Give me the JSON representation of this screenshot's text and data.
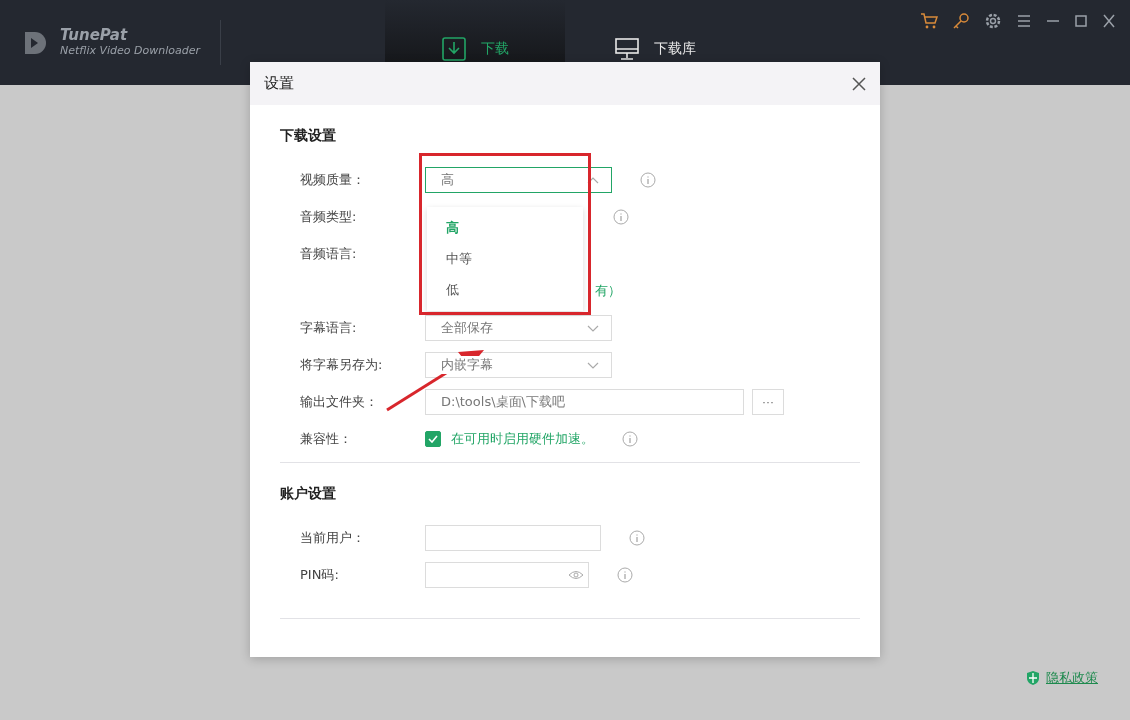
{
  "app": {
    "name": "TunePat",
    "subtitle": "Netflix Video Downloader"
  },
  "tabs": [
    {
      "label": "下载",
      "kind": "download",
      "selected": true
    },
    {
      "label": "下载库",
      "kind": "library",
      "selected": false
    }
  ],
  "dialog": {
    "title": "设置",
    "sections": [
      {
        "title": "下载设置",
        "rows": [
          {
            "label": "视频质量：",
            "kind": "select",
            "value": "高",
            "open": true,
            "info": true
          },
          {
            "label": "音频类型:",
            "kind": "covered",
            "info": true
          },
          {
            "label": "音频语言:",
            "kind": "covered",
            "info": false,
            "note": "有）"
          },
          {
            "label": "字幕语言:",
            "kind": "select",
            "value": "全部保存",
            "open": false,
            "info": false
          },
          {
            "label": "将字幕另存为:",
            "kind": "select",
            "value": "内嵌字幕",
            "open": false,
            "info": false
          },
          {
            "label": "输出文件夹：",
            "kind": "path",
            "value": "D:\\tools\\桌面\\下载吧",
            "button": "···",
            "info": false
          },
          {
            "label": "兼容性：",
            "kind": "checkbox",
            "text": "在可用时启用硬件加速。",
            "checked": true,
            "info": true
          }
        ]
      },
      {
        "title": "账户设置",
        "rows": [
          {
            "label": "当前用户：",
            "kind": "text",
            "info": true
          },
          {
            "label": "PIN码:",
            "kind": "password",
            "info": true
          }
        ]
      }
    ]
  },
  "dropdown": {
    "options": [
      {
        "label": "高",
        "selected": true
      },
      {
        "label": "中等",
        "selected": false
      },
      {
        "label": "低",
        "selected": false
      }
    ]
  },
  "privacy": "隐私政策"
}
